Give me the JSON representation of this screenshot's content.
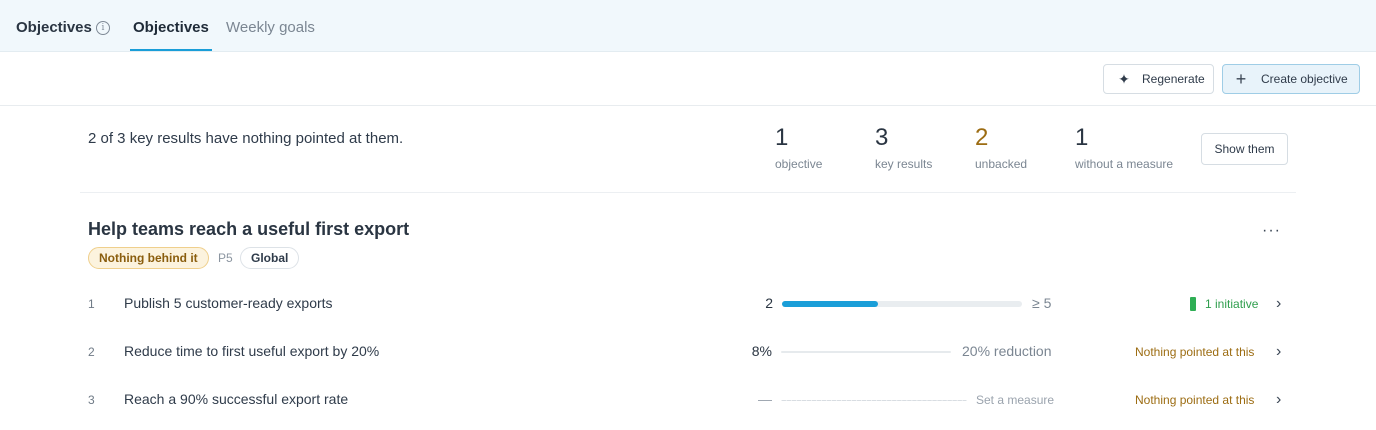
{
  "header": {
    "app_title": "Objectives",
    "info_icon": "info-icon",
    "tabs": [
      {
        "label": "Objectives",
        "active": true
      },
      {
        "label": "Weekly goals",
        "active": false
      }
    ],
    "accent": "#1a9ed8"
  },
  "toolbar": {
    "regenerate_label": "Regenerate",
    "regenerate_icon": "sparkle-icon",
    "create_label": "Create objective",
    "create_icon": "plus-icon"
  },
  "summary": {
    "text": "2 of 3 key results have nothing pointed at them.",
    "stats": [
      {
        "value": "1",
        "label": "objective"
      },
      {
        "value": "3",
        "label": "key results"
      },
      {
        "value": "2",
        "label": "unbacked"
      },
      {
        "value": "1",
        "label": "without a measure"
      }
    ],
    "show_label": "Show them"
  },
  "objective": {
    "title": "Help teams reach a useful first export",
    "more_label": "···",
    "badges": {
      "status": "Nothing behind it",
      "priority": "P5",
      "scope": "Global"
    },
    "key_results": [
      {
        "num": "1",
        "text": "Publish 5 customer-ready exports",
        "current": "2",
        "progress": 0.4,
        "target": "≥ 5",
        "status": "1 initiative"
      },
      {
        "num": "2",
        "text": "Reduce time to first useful export by 20%",
        "current": "8%",
        "target": "20% reduction",
        "status": "Nothing pointed at this"
      },
      {
        "num": "3",
        "text": "Reach a 90% successful export rate",
        "current": "—",
        "target": "Set a measure",
        "status": "Nothing pointed at this"
      }
    ]
  },
  "colors": {
    "warn": "#9c6c12",
    "ok": "#2f9e4d"
  }
}
